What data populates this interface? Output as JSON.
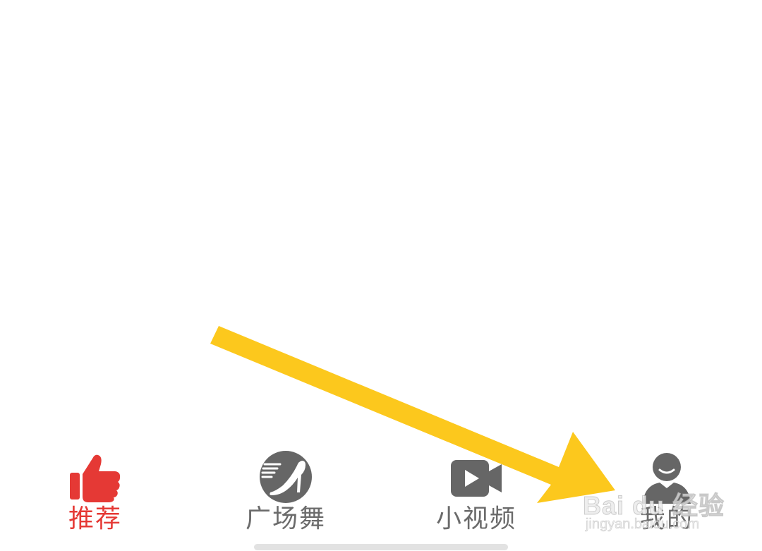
{
  "tabbar": {
    "tabs": [
      {
        "key": "recommend",
        "label": "推荐",
        "icon": "thumbs-up-icon",
        "active": true
      },
      {
        "key": "square-dance",
        "label": "广场舞",
        "icon": "high-heel-shoe-icon",
        "active": false
      },
      {
        "key": "short-video",
        "label": "小视频",
        "icon": "video-camera-icon",
        "active": false
      },
      {
        "key": "mine",
        "label": "我的",
        "icon": "user-profile-icon",
        "active": false
      }
    ]
  },
  "colors": {
    "active": "#e53935",
    "inactive": "#666666",
    "annotation_arrow": "#fcc81d"
  },
  "watermark": {
    "brand": "Bai du 经验",
    "url": "jingyan.baidu.com"
  }
}
